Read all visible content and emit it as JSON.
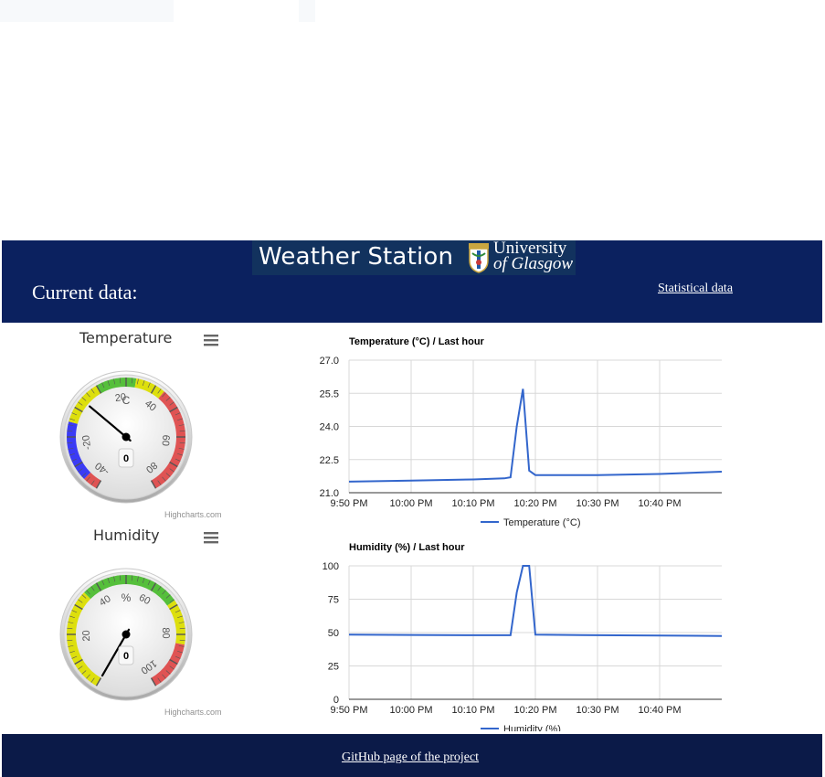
{
  "header": {
    "logo_text": "Weather Station",
    "uni_line1": "University",
    "uni_line2": "of Glasgow",
    "current_label": "Current data:",
    "stat_link": "Statistical data"
  },
  "gauges": [
    {
      "title": "Temperature",
      "unit": "C",
      "value": 0,
      "min": -40,
      "max": 80,
      "ticks": [
        "-40",
        "-20",
        "20",
        "40",
        "60",
        "80"
      ],
      "credits": "Highcharts.com"
    },
    {
      "title": "Humidity",
      "unit": "%",
      "value": 0,
      "min": 0,
      "max": 100,
      "ticks": [
        "20",
        "40",
        "60",
        "80",
        "100"
      ],
      "credits": "Highcharts.com"
    }
  ],
  "chart_data": [
    {
      "type": "line",
      "title": "Temperature (°C) / Last hour",
      "x_ticks": [
        "9:50 PM",
        "10:00 PM",
        "10:10 PM",
        "10:20 PM",
        "10:30 PM",
        "10:40 PM"
      ],
      "y_ticks": [
        "21.0",
        "22.5",
        "24.0",
        "25.5",
        "27.0"
      ],
      "ylim": [
        21.0,
        27.0
      ],
      "grid": true,
      "legend_position": "bottom",
      "series": [
        {
          "name": "Temperature (°C)",
          "color": "#3366cc",
          "x": [
            "9:50 PM",
            "10:00 PM",
            "10:10 PM",
            "10:15 PM",
            "10:16 PM",
            "10:17 PM",
            "10:18 PM",
            "10:19 PM",
            "10:20 PM",
            "10:30 PM",
            "10:40 PM",
            "10:50 PM"
          ],
          "y": [
            21.5,
            21.55,
            21.6,
            21.65,
            21.7,
            24.0,
            25.7,
            22.0,
            21.8,
            21.8,
            21.85,
            21.95
          ]
        }
      ]
    },
    {
      "type": "line",
      "title": "Humidity (%) / Last hour",
      "x_ticks": [
        "9:50 PM",
        "10:00 PM",
        "10:10 PM",
        "10:20 PM",
        "10:30 PM",
        "10:40 PM"
      ],
      "y_ticks": [
        "0",
        "25",
        "50",
        "75",
        "100"
      ],
      "ylim": [
        0,
        100
      ],
      "grid": true,
      "legend_position": "bottom",
      "series": [
        {
          "name": "Humidity (%)",
          "color": "#3366cc",
          "x": [
            "9:50 PM",
            "10:00 PM",
            "10:10 PM",
            "10:16 PM",
            "10:17 PM",
            "10:18 PM",
            "10:19 PM",
            "10:20 PM",
            "10:30 PM",
            "10:40 PM",
            "10:50 PM"
          ],
          "y": [
            48.5,
            48.2,
            48.0,
            48.0,
            80,
            100,
            100,
            48.5,
            48.0,
            47.8,
            47.5
          ]
        }
      ]
    }
  ],
  "footer": {
    "github_link": "GitHub page of the project"
  }
}
